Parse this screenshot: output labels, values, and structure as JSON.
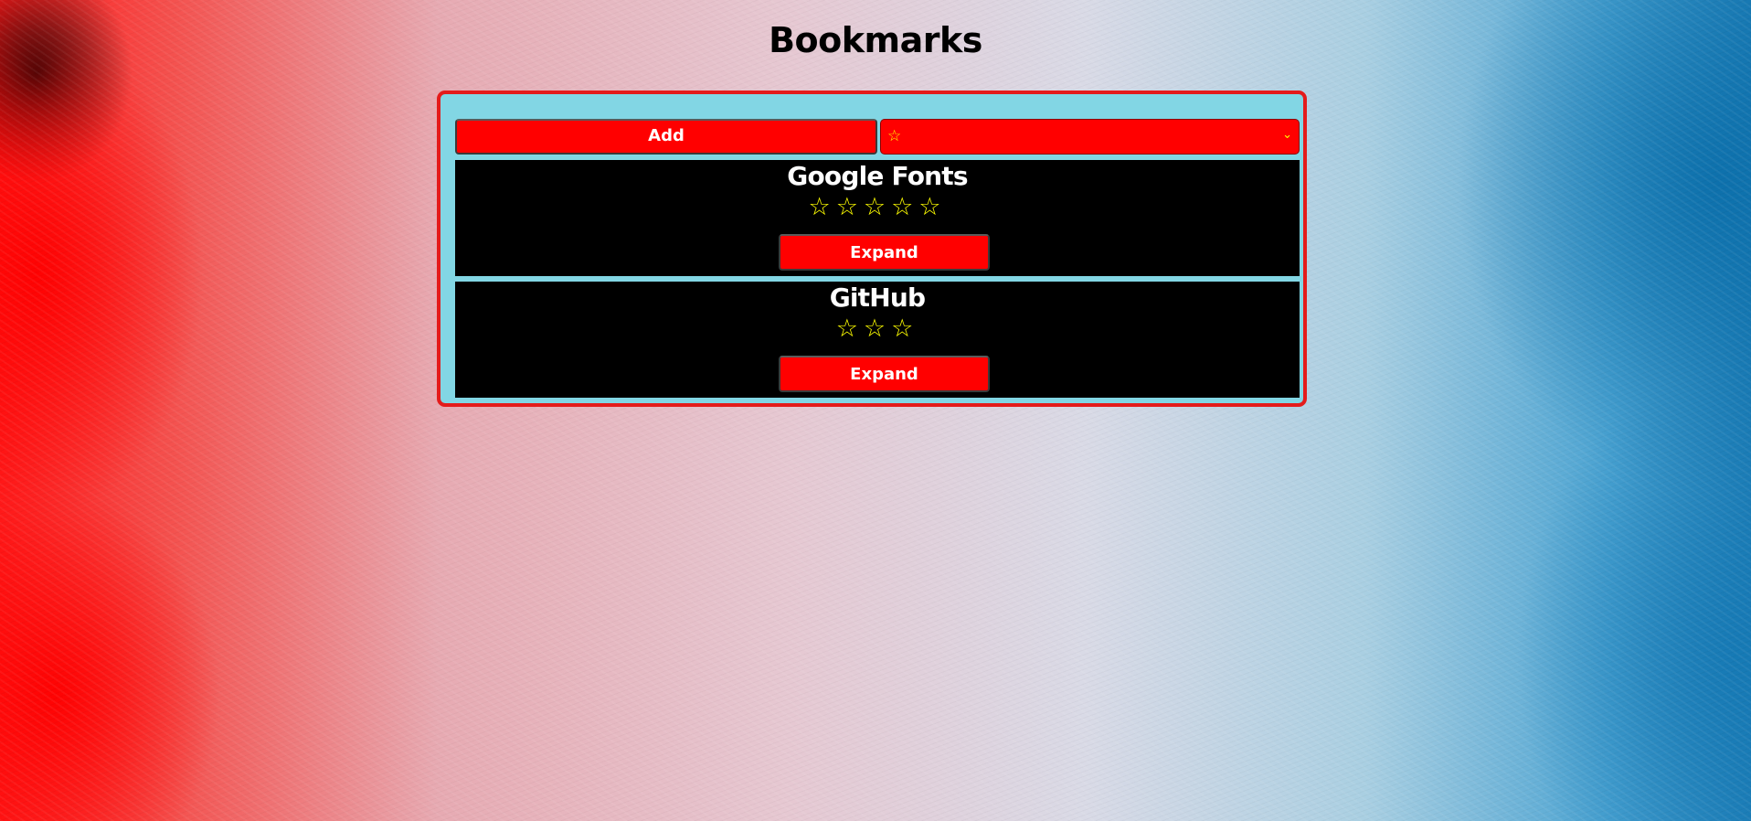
{
  "page": {
    "title": "Bookmarks"
  },
  "toolbar": {
    "add_label": "Add",
    "rating_select": {
      "selected": "☆",
      "chevron": "⌄"
    }
  },
  "bookmarks": [
    {
      "title": "Google Fonts",
      "rating": 5,
      "stars": "☆☆☆☆☆",
      "expand_label": "Expand"
    },
    {
      "title": "GitHub",
      "rating": 3,
      "stars": "☆☆☆",
      "expand_label": "Expand"
    }
  ],
  "colors": {
    "panel_bg": "#82d6e4",
    "panel_border": "#e41b1b",
    "button_bg": "#ff0000",
    "star": "#ffff00",
    "card_bg": "#000000"
  }
}
